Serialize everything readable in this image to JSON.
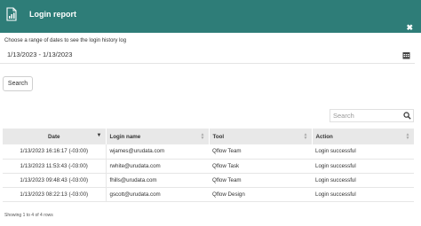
{
  "header": {
    "title": "Login report",
    "icon": "report-icon",
    "close_icon": "close-icon"
  },
  "filter": {
    "prompt": "Choose a range of dates to see the login history log",
    "date_range": "1/13/2023 - 1/13/2023",
    "calendar_icon": "calendar-icon",
    "search_button": "Search"
  },
  "table_search": {
    "placeholder": "Search",
    "icon": "search-icon"
  },
  "table": {
    "columns": [
      "Date",
      "Login name",
      "Tool",
      "Action"
    ],
    "sorted_column": "Date",
    "rows": [
      {
        "date": "1/13/2023 16:16:17 (-03:00)",
        "login": "wjames@urudata.com",
        "tool": "Qflow Team",
        "action": "Login successful"
      },
      {
        "date": "1/13/2023 11:53:43 (-03:00)",
        "login": "rwhite@urudata.com",
        "tool": "Qflow Task",
        "action": "Login successful"
      },
      {
        "date": "1/13/2023 09:48:43 (-03:00)",
        "login": "fhills@urudata.com",
        "tool": "Qflow Team",
        "action": "Login successful"
      },
      {
        "date": "1/13/2023 08:22:13 (-03:00)",
        "login": "gscott@urudata.com",
        "tool": "Qflow Design",
        "action": "Login successful"
      }
    ]
  },
  "footer": {
    "info": "Showing 1 to 4 of 4 rows"
  },
  "colors": {
    "header_bg": "#2e7d78",
    "table_header_bg": "#e8e8e8"
  }
}
